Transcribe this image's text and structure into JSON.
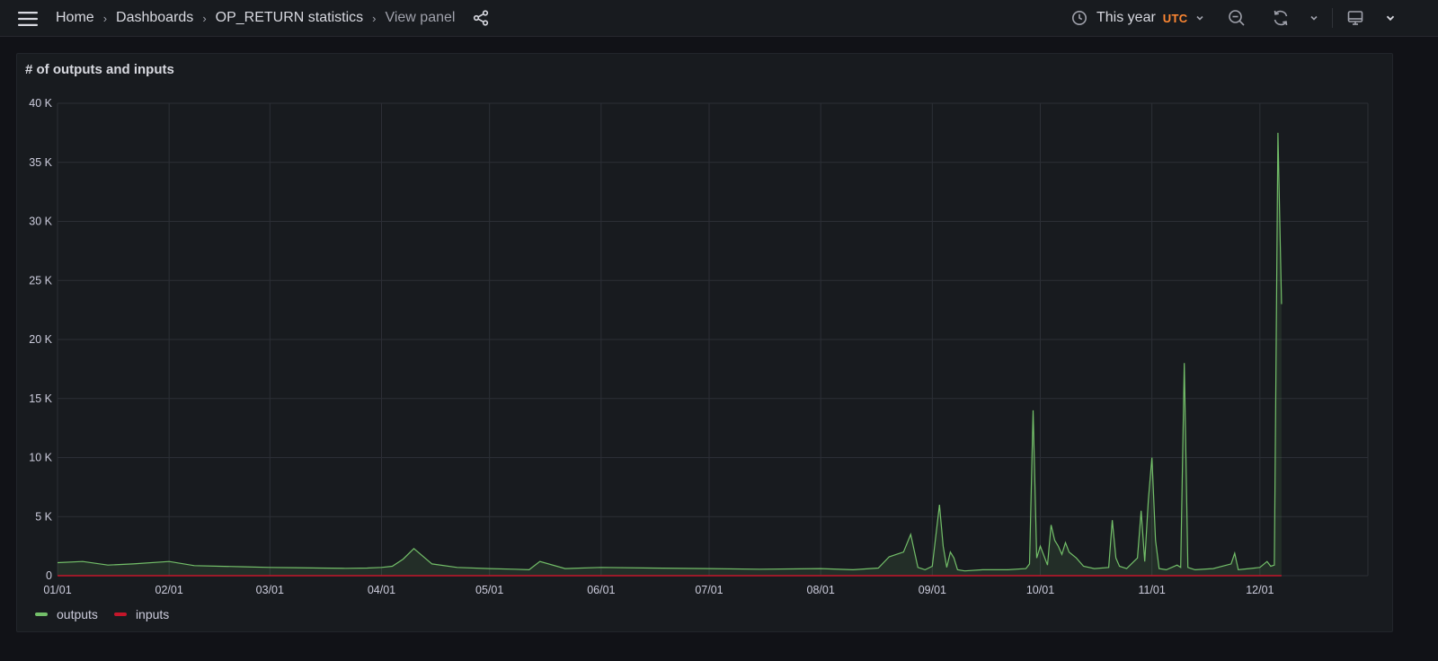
{
  "breadcrumb": {
    "items": [
      "Home",
      "Dashboards",
      "OP_RETURN statistics"
    ],
    "current": "View panel"
  },
  "toolbar": {
    "time_range": "This year",
    "timezone": "UTC"
  },
  "icons": {
    "menu": "menu-icon",
    "share": "share-icon",
    "clock": "clock-icon",
    "zoom_out": "zoom-out-icon",
    "refresh": "refresh-icon",
    "monitor": "monitor-icon"
  },
  "panel": {
    "title": "# of outputs and inputs"
  },
  "colors": {
    "outputs": "#73bf69",
    "inputs": "#c4162a",
    "timezone": "#ff8833",
    "grid": "#2c2f36"
  },
  "chart_data": {
    "type": "line",
    "title": "# of outputs and inputs",
    "xlabel": "",
    "ylabel": "",
    "x_ticks": [
      "01/01",
      "02/01",
      "03/01",
      "04/01",
      "05/01",
      "06/01",
      "07/01",
      "08/01",
      "09/01",
      "10/01",
      "11/01",
      "12/01"
    ],
    "y_ticks": [
      "0",
      "5 K",
      "10 K",
      "15 K",
      "20 K",
      "25 K",
      "30 K",
      "35 K",
      "40 K"
    ],
    "ylim": [
      0,
      40000
    ],
    "xlim": [
      "2023-01-01",
      "2023-12-31"
    ],
    "grid": true,
    "legend": "bottom-left",
    "series": [
      {
        "name": "outputs",
        "x": [
          "2023-01-01",
          "2023-01-08",
          "2023-01-15",
          "2023-01-22",
          "2023-02-01",
          "2023-02-08",
          "2023-02-15",
          "2023-02-22",
          "2023-03-01",
          "2023-03-08",
          "2023-03-15",
          "2023-03-22",
          "2023-03-28",
          "2023-04-01",
          "2023-04-04",
          "2023-04-07",
          "2023-04-10",
          "2023-04-15",
          "2023-04-22",
          "2023-05-01",
          "2023-05-08",
          "2023-05-12",
          "2023-05-15",
          "2023-05-22",
          "2023-06-01",
          "2023-06-15",
          "2023-07-01",
          "2023-07-15",
          "2023-08-01",
          "2023-08-10",
          "2023-08-17",
          "2023-08-20",
          "2023-08-22",
          "2023-08-24",
          "2023-08-26",
          "2023-08-28",
          "2023-08-29",
          "2023-08-30",
          "2023-09-01",
          "2023-09-03",
          "2023-09-04",
          "2023-09-05",
          "2023-09-06",
          "2023-09-07",
          "2023-09-08",
          "2023-09-10",
          "2023-09-15",
          "2023-09-22",
          "2023-09-27",
          "2023-09-28",
          "2023-09-29",
          "2023-09-30",
          "2023-10-01",
          "2023-10-03",
          "2023-10-04",
          "2023-10-05",
          "2023-10-06",
          "2023-10-07",
          "2023-10-08",
          "2023-10-09",
          "2023-10-11",
          "2023-10-13",
          "2023-10-16",
          "2023-10-20",
          "2023-10-21",
          "2023-10-22",
          "2023-10-23",
          "2023-10-25",
          "2023-10-27",
          "2023-10-28",
          "2023-10-29",
          "2023-10-30",
          "2023-10-31",
          "2023-11-01",
          "2023-11-02",
          "2023-11-03",
          "2023-11-05",
          "2023-11-08",
          "2023-11-09",
          "2023-11-10",
          "2023-11-11",
          "2023-11-13",
          "2023-11-18",
          "2023-11-23",
          "2023-11-24",
          "2023-11-25",
          "2023-11-28",
          "2023-12-01",
          "2023-12-03",
          "2023-12-04",
          "2023-12-05",
          "2023-12-06",
          "2023-12-07"
        ],
        "values": [
          1100,
          1200,
          900,
          1000,
          1200,
          850,
          800,
          750,
          700,
          680,
          650,
          620,
          650,
          700,
          800,
          1400,
          2300,
          1000,
          700,
          600,
          550,
          500,
          1200,
          600,
          700,
          650,
          600,
          550,
          600,
          500,
          650,
          1600,
          1800,
          2000,
          3500,
          700,
          600,
          500,
          800,
          6000,
          2500,
          700,
          2000,
          1500,
          500,
          400,
          500,
          500,
          600,
          1000,
          14000,
          1500,
          2500,
          900,
          4300,
          3000,
          2500,
          1800,
          2800,
          2000,
          1500,
          800,
          600,
          700,
          4700,
          1500,
          800,
          600,
          1200,
          1500,
          5500,
          1200,
          6400,
          10000,
          3000,
          600,
          500,
          900,
          700,
          18000,
          700,
          500,
          600,
          1000,
          1900,
          500,
          600,
          700,
          1200,
          800,
          900,
          37500,
          23000
        ]
      },
      {
        "name": "inputs",
        "x": [
          "2023-01-01",
          "2023-12-07"
        ],
        "values": [
          0,
          0
        ]
      }
    ]
  }
}
